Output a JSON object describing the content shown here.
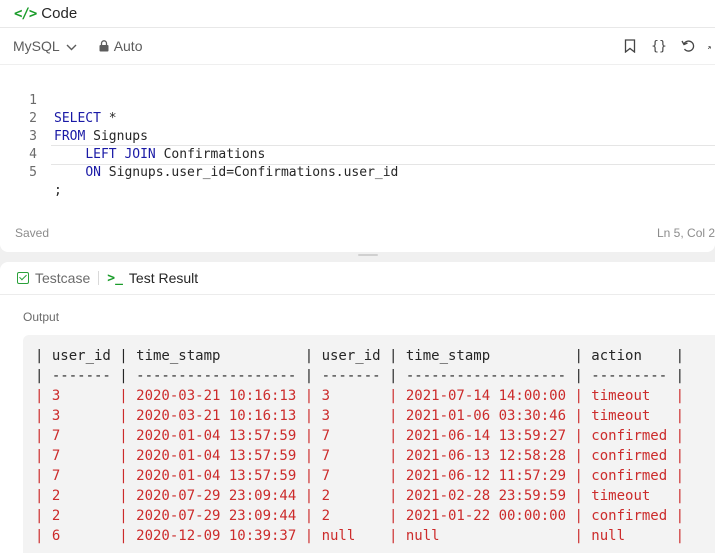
{
  "code_panel": {
    "title": "Code",
    "language": "MySQL",
    "mode": "Auto",
    "status_saved": "Saved",
    "cursor_position": "Ln 5, Col 2",
    "icons": [
      "code-icon",
      "chevron-down-icon",
      "lock-icon",
      "bookmark-icon",
      "braces-icon",
      "undo-icon",
      "collapse-icon"
    ]
  },
  "editor": {
    "line_numbers": [
      "1",
      "2",
      "3",
      "4",
      "5"
    ],
    "lines": [
      {
        "kw1": "SELECT",
        "rest": " *"
      },
      {
        "kw1": "FROM",
        "rest": " Signups"
      },
      {
        "indent": "    ",
        "kw1": "LEFT JOIN",
        "rest": " Confirmations"
      },
      {
        "indent": "    ",
        "kw1": "ON",
        "rest": " Signups.user_id=Confirmations.user_id"
      },
      {
        "rest": ";"
      }
    ]
  },
  "result_panel": {
    "tab_testcase": "Testcase",
    "tab_result": "Test Result",
    "output_label": "Output"
  },
  "table": {
    "header_row": "| user_id | time_stamp          | user_id | time_stamp          | action    |",
    "separator_row": "| ------- | ------------------- | ------- | ------------------- | --------- |",
    "rows": [
      "| 3       | 2020-03-21 10:16:13 | 3       | 2021-07-14 14:00:00 | timeout   |",
      "| 3       | 2020-03-21 10:16:13 | 3       | 2021-01-06 03:30:46 | timeout   |",
      "| 7       | 2020-01-04 13:57:59 | 7       | 2021-06-14 13:59:27 | confirmed |",
      "| 7       | 2020-01-04 13:57:59 | 7       | 2021-06-13 12:58:28 | confirmed |",
      "| 7       | 2020-01-04 13:57:59 | 7       | 2021-06-12 11:57:29 | confirmed |",
      "| 2       | 2020-07-29 23:09:44 | 2       | 2021-02-28 23:59:59 | timeout   |",
      "| 2       | 2020-07-29 23:09:44 | 2       | 2021-01-22 00:00:00 | confirmed |",
      "| 6       | 2020-12-09 10:39:37 | null    | null                | null      |"
    ]
  },
  "colors": {
    "diff_red": "#cc2b2b",
    "keyword_blue": "#1a1aa6",
    "accent_green": "#1a9c2a"
  }
}
